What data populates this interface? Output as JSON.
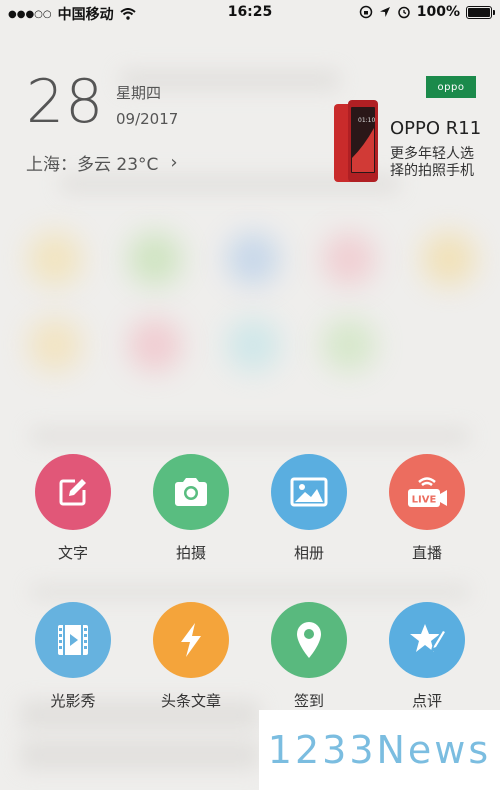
{
  "status_bar": {
    "carrier": "中国移动",
    "time": "16:25",
    "battery": "100%"
  },
  "header": {
    "day": "28",
    "weekday": "星期四",
    "month_year": "09/2017",
    "weather": "上海：多云 23°C"
  },
  "ad": {
    "logo": "oppo",
    "title": "OPPO R11",
    "line1": "更多年轻人选",
    "line2": "择的拍照手机"
  },
  "actions": {
    "text": {
      "label": "文字",
      "color": "#e15778",
      "icon": "edit-icon"
    },
    "photo": {
      "label": "拍摄",
      "color": "#59bd80",
      "icon": "camera-icon"
    },
    "album": {
      "label": "相册",
      "color": "#5aaee0",
      "icon": "image-icon"
    },
    "live": {
      "label": "直播",
      "color": "#ec6d5f",
      "icon": "live-icon",
      "badge": "LIVE"
    },
    "video": {
      "label": "光影秀",
      "color": "#66b2df",
      "icon": "film-icon"
    },
    "article": {
      "label": "头条文章",
      "color": "#f4a43b",
      "icon": "lightning-icon"
    },
    "checkin": {
      "label": "签到",
      "color": "#59b97e",
      "icon": "location-pin-icon"
    },
    "review": {
      "label": "点评",
      "color": "#5aaee0",
      "icon": "star-pen-icon"
    }
  },
  "watermark": "1233News"
}
